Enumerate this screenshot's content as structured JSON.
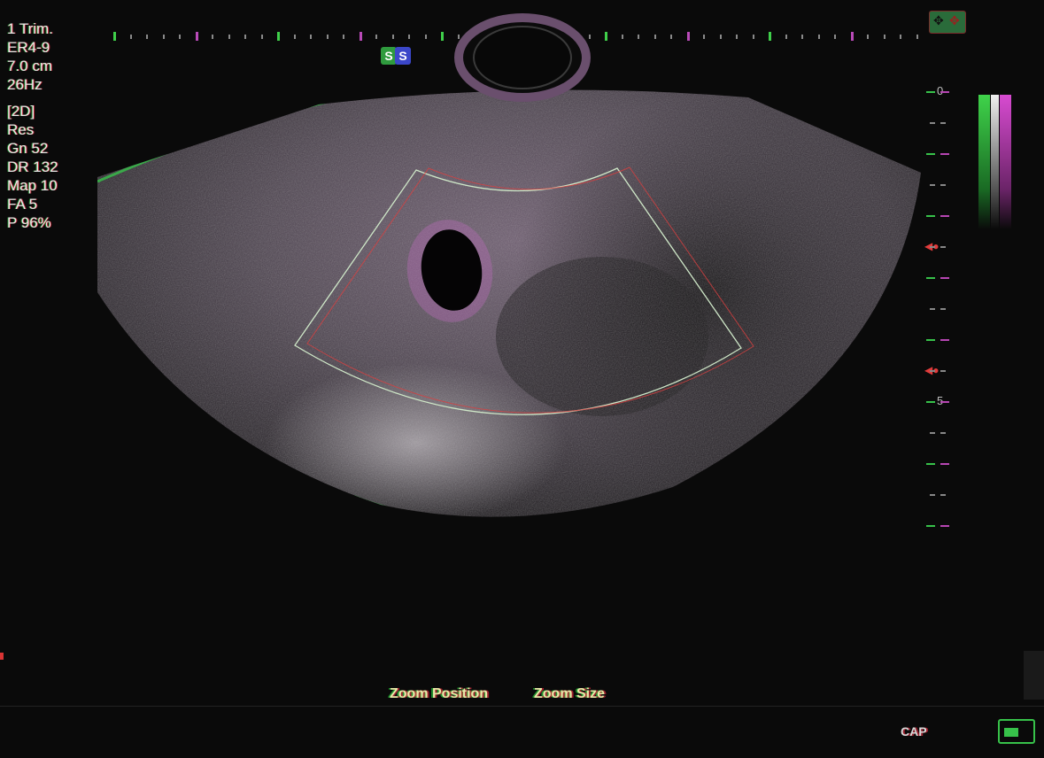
{
  "params": {
    "preset": "1 Trim.",
    "transducer": "ER4-9",
    "depth": "7.0 cm",
    "frame_rate": "26Hz",
    "mode": "[2D]",
    "res": "Res",
    "gain": "Gn 52",
    "dynamic_range": "DR 132",
    "map": "Map 10",
    "fa": "FA 5",
    "power": "P 96%"
  },
  "image": {
    "orientation_marker": "S"
  },
  "depth_scale": {
    "top_label": "0",
    "mid_label": "5"
  },
  "footer": {
    "zoom_position_label": "Zoom Position",
    "zoom_size_label": "Zoom Size",
    "capture_label": "CAP"
  },
  "colors": {
    "green_overlay": "#37c24a",
    "magenta_overlay": "#b746b3",
    "red_overlay": "#e33b3b",
    "background": "#0a0a0a"
  },
  "icons": {
    "top_right": "probe-settings-icon",
    "bottom_right": "capture-icon"
  }
}
